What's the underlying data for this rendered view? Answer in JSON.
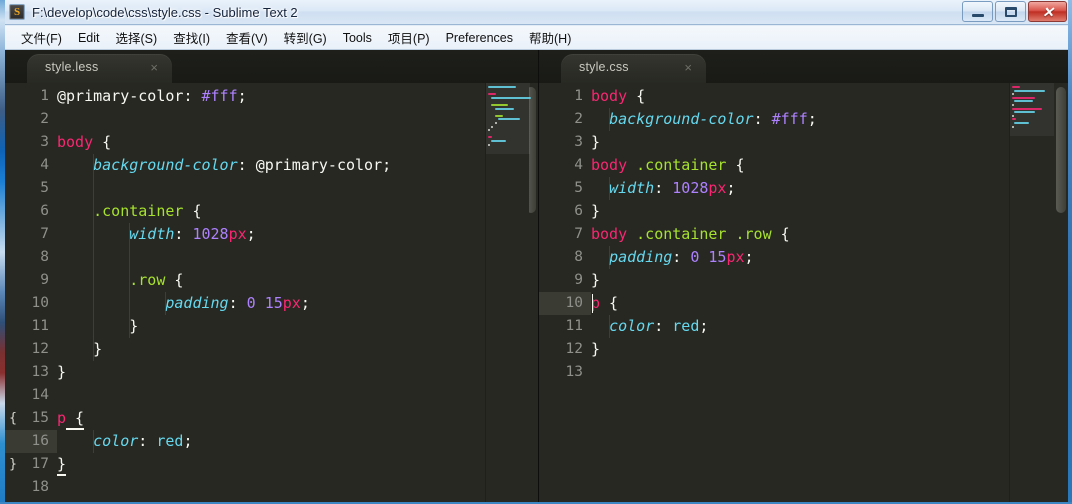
{
  "window": {
    "title": "F:\\develop\\code\\css\\style.css - Sublime Text 2",
    "app_icon": "S",
    "controls": {
      "minimize": "minimize-icon",
      "maximize": "maximize-icon",
      "close": "✕"
    }
  },
  "menubar": {
    "items": [
      {
        "label": "文件(F)"
      },
      {
        "label": "Edit"
      },
      {
        "label": "选择(S)"
      },
      {
        "label": "查找(I)"
      },
      {
        "label": "查看(V)"
      },
      {
        "label": "转到(G)"
      },
      {
        "label": "Tools"
      },
      {
        "label": "项目(P)"
      },
      {
        "label": "Preferences"
      },
      {
        "label": "帮助(H)"
      }
    ]
  },
  "panes": {
    "left": {
      "tab": {
        "label": "style.less",
        "close": "×",
        "active": true
      },
      "active_line": 16,
      "fold_markers": [
        {
          "line": 15,
          "glyph": "{"
        },
        {
          "line": 17,
          "glyph": "}"
        }
      ],
      "line_count": 18,
      "lines": [
        {
          "n": 1,
          "text": "@primary-color: #fff;"
        },
        {
          "n": 2,
          "text": ""
        },
        {
          "n": 3,
          "text": "body {"
        },
        {
          "n": 4,
          "text": "    background-color: @primary-color;"
        },
        {
          "n": 5,
          "text": ""
        },
        {
          "n": 6,
          "text": "    .container {"
        },
        {
          "n": 7,
          "text": "        width: 1028px;"
        },
        {
          "n": 8,
          "text": ""
        },
        {
          "n": 9,
          "text": "        .row {"
        },
        {
          "n": 10,
          "text": "            padding: 0 15px;"
        },
        {
          "n": 11,
          "text": "        }"
        },
        {
          "n": 12,
          "text": "    }"
        },
        {
          "n": 13,
          "text": "}"
        },
        {
          "n": 14,
          "text": ""
        },
        {
          "n": 15,
          "text": "p {"
        },
        {
          "n": 16,
          "text": "    color: red;"
        },
        {
          "n": 17,
          "text": "}"
        },
        {
          "n": 18,
          "text": ""
        }
      ]
    },
    "right": {
      "tab": {
        "label": "style.css",
        "close": "×",
        "active": true
      },
      "active_line": 10,
      "line_count": 13,
      "lines": [
        {
          "n": 1,
          "text": "body {"
        },
        {
          "n": 2,
          "text": "  background-color: #fff;"
        },
        {
          "n": 3,
          "text": "}"
        },
        {
          "n": 4,
          "text": "body .container {"
        },
        {
          "n": 5,
          "text": "  width: 1028px;"
        },
        {
          "n": 6,
          "text": "}"
        },
        {
          "n": 7,
          "text": "body .container .row {"
        },
        {
          "n": 8,
          "text": "  padding: 0 15px;"
        },
        {
          "n": 9,
          "text": "}"
        },
        {
          "n": 10,
          "text": "p {"
        },
        {
          "n": 11,
          "text": "  color: red;"
        },
        {
          "n": 12,
          "text": "}"
        },
        {
          "n": 13,
          "text": ""
        }
      ]
    }
  },
  "theme": {
    "editor_bg": "#272822",
    "tabbar_bg": "#1e1f1a",
    "linenumber": "#8f908a",
    "selector_tag": "#f92672",
    "selector_class": "#a6e22e",
    "property": "#66d9ef",
    "number": "#ae81ff",
    "unit": "#f92672",
    "plain": "#f8f8f2",
    "active_line": "#3a3b33",
    "titlebar_text": "#15233a"
  }
}
